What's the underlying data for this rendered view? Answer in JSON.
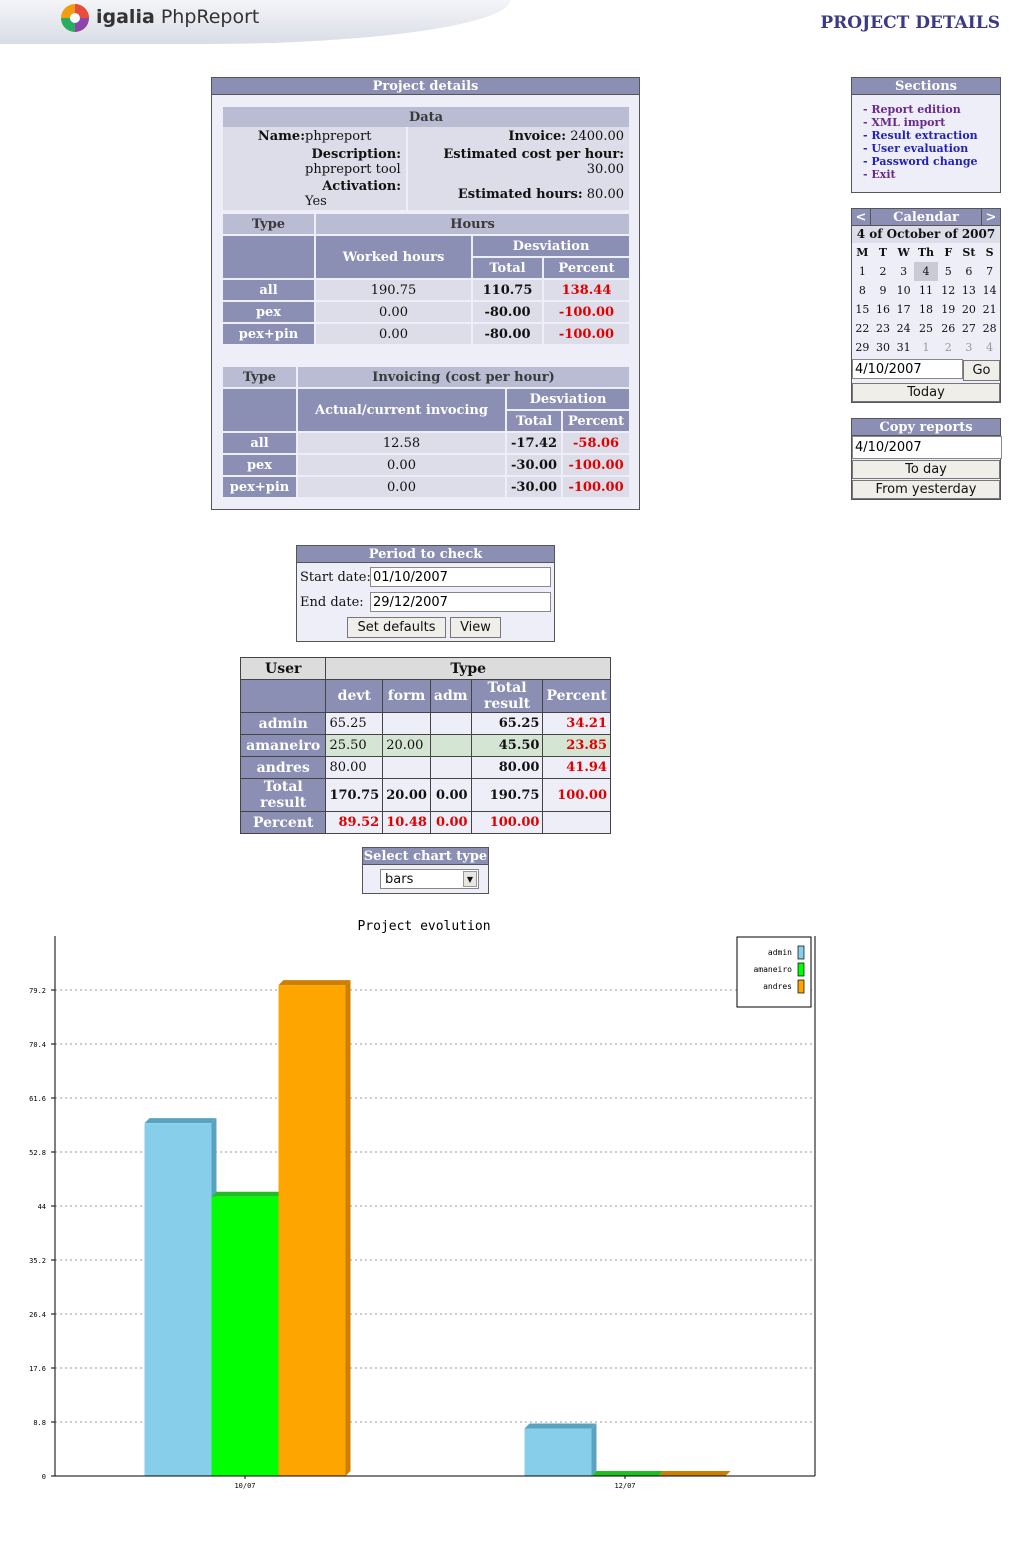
{
  "header": {
    "logo_brand": "igalia",
    "logo_product": "PhpReport",
    "page_title": "PROJECT DETAILS"
  },
  "project_details": {
    "title": "Project details",
    "data": {
      "title": "Data",
      "name_label": "Name:",
      "name_value": "phpreport",
      "description_label": "Description:",
      "description_value": "phpreport tool",
      "activation_label": "Activation:",
      "activation_value": "Yes",
      "invoice_label": "Invoice:",
      "invoice_value": "2400.00",
      "cost_label": "Estimated cost per hour:",
      "cost_value": "30.00",
      "hours_label": "Estimated hours:",
      "hours_value": "80.00"
    },
    "hours_table": {
      "type_header": "Type",
      "hours_header": "Hours",
      "worked_header": "Worked hours",
      "desviation_header": "Desviation",
      "total_header": "Total",
      "percent_header": "Percent",
      "rows": [
        {
          "type": "all",
          "worked": "190.75",
          "total": "110.75",
          "percent": "138.44"
        },
        {
          "type": "pex",
          "worked": "0.00",
          "total": "-80.00",
          "percent": "-100.00"
        },
        {
          "type": "pex+pin",
          "worked": "0.00",
          "total": "-80.00",
          "percent": "-100.00"
        }
      ]
    },
    "invoicing_table": {
      "type_header": "Type",
      "invoicing_header": "Invoicing (cost per hour)",
      "actual_header": "Actual/current invocing",
      "desviation_header": "Desviation",
      "total_header": "Total",
      "percent_header": "Percent",
      "rows": [
        {
          "type": "all",
          "actual": "12.58",
          "total": "-17.42",
          "percent": "-58.06"
        },
        {
          "type": "pex",
          "actual": "0.00",
          "total": "-30.00",
          "percent": "-100.00"
        },
        {
          "type": "pex+pin",
          "actual": "0.00",
          "total": "-30.00",
          "percent": "-100.00"
        }
      ]
    }
  },
  "period": {
    "title": "Period to check",
    "start_label": "Start date:",
    "start_value": "01/10/2007",
    "end_label": "End date:",
    "end_value": "29/12/2007",
    "defaults_button": "Set defaults",
    "view_button": "View"
  },
  "user_table": {
    "user_header": "User",
    "type_header": "Type",
    "columns": [
      "devt",
      "form",
      "adm",
      "Total result",
      "Percent"
    ],
    "rows": [
      {
        "user": "admin",
        "devt": "65.25",
        "form": "",
        "adm": "",
        "total": "65.25",
        "percent": "34.21"
      },
      {
        "user": "amaneiro",
        "devt": "25.50",
        "form": "20.00",
        "adm": "",
        "total": "45.50",
        "percent": "23.85"
      },
      {
        "user": "andres",
        "devt": "80.00",
        "form": "",
        "adm": "",
        "total": "80.00",
        "percent": "41.94"
      }
    ],
    "total_row": {
      "label": "Total result",
      "devt": "170.75",
      "form": "20.00",
      "adm": "0.00",
      "total": "190.75",
      "percent": "100.00"
    },
    "percent_row": {
      "label": "Percent",
      "devt": "89.52",
      "form": "10.48",
      "adm": "0.00",
      "total": "100.00"
    }
  },
  "chart_select": {
    "title": "Select chart type",
    "selected": "bars"
  },
  "sidebar": {
    "sections_title": "Sections",
    "links": [
      {
        "label": "- Report edition"
      },
      {
        "label": "- XML import"
      },
      {
        "label": "- Result extraction"
      },
      {
        "label": "- User evaluation"
      },
      {
        "label": "- Password change"
      },
      {
        "label": "- Exit"
      }
    ],
    "calendar": {
      "prev": "<",
      "next": ">",
      "title": "Calendar",
      "date_caption": "4 of October of 2007",
      "weekdays": [
        "M",
        "T",
        "W",
        "Th",
        "F",
        "St",
        "S"
      ],
      "weeks": [
        [
          "1",
          "2",
          "3",
          "4",
          "5",
          "6",
          "7"
        ],
        [
          "8",
          "9",
          "10",
          "11",
          "12",
          "13",
          "14"
        ],
        [
          "15",
          "16",
          "17",
          "18",
          "19",
          "20",
          "21"
        ],
        [
          "22",
          "23",
          "24",
          "25",
          "26",
          "27",
          "28"
        ],
        [
          "29",
          "30",
          "31",
          "1",
          "2",
          "3",
          "4"
        ]
      ],
      "input_value": "4/10/2007",
      "go_button": "Go",
      "today_button": "Today"
    },
    "copy_reports": {
      "title": "Copy reports",
      "input_value": "4/10/2007",
      "today_button": "To day",
      "yesterday_button": "From yesterday"
    }
  },
  "chart_data": {
    "type": "bar",
    "title": "Project evolution",
    "categories": [
      "10/07",
      "12/07"
    ],
    "series": [
      {
        "name": "admin",
        "values": [
          57.5,
          7.75
        ],
        "color": "#87ceeb"
      },
      {
        "name": "amaneiro",
        "values": [
          45.5,
          0
        ],
        "color": "#00ff00"
      },
      {
        "name": "andres",
        "values": [
          80,
          0
        ],
        "color": "#ffa500"
      }
    ],
    "ylim": [
      0,
      88
    ],
    "yticks": [
      "0",
      "8.8",
      "17.6",
      "26.4",
      "35.2",
      "44",
      "52.8",
      "61.6",
      "70.4",
      "79.2"
    ],
    "grid": true,
    "legend_position": "top-right"
  }
}
